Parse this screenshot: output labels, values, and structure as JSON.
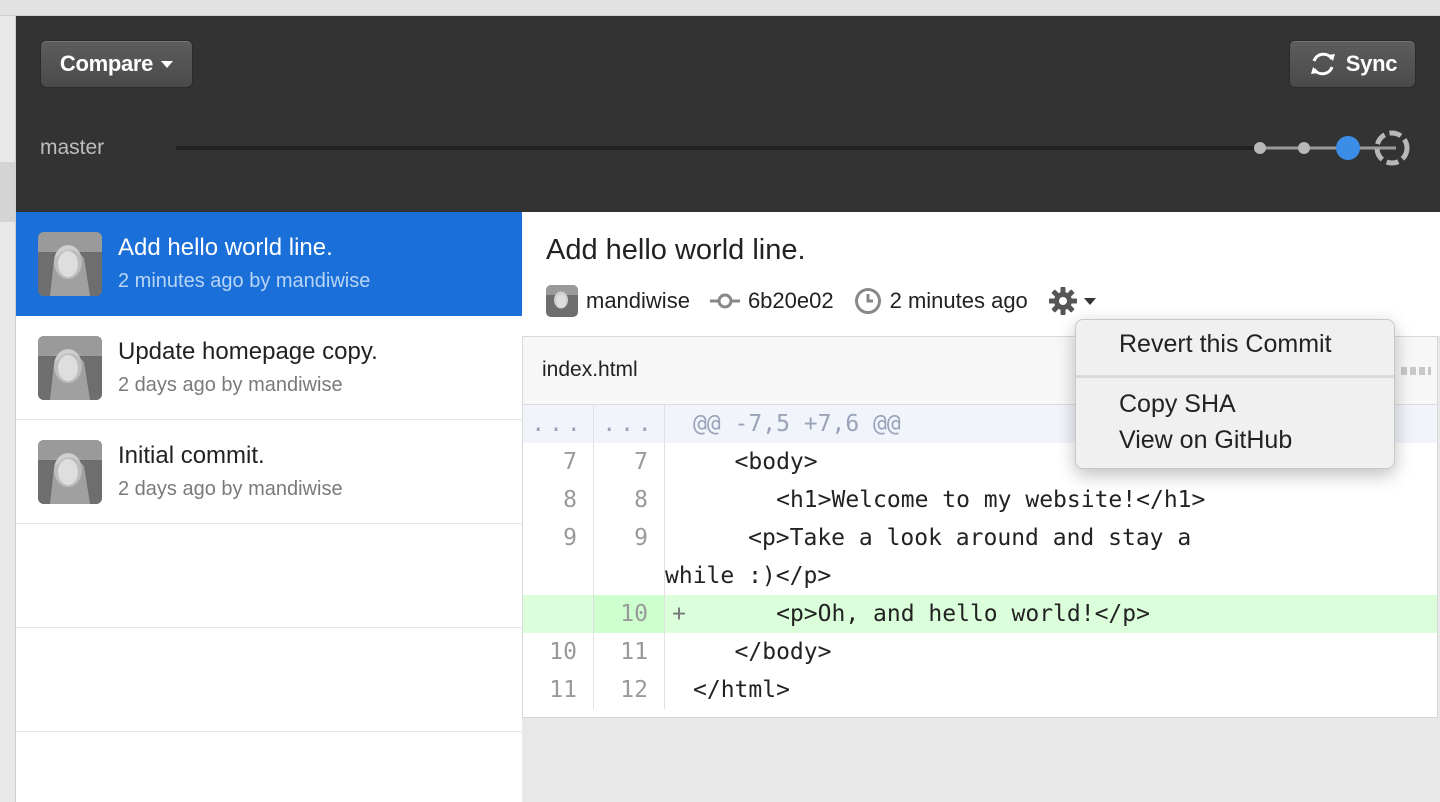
{
  "toolbar": {
    "compare_label": "Compare",
    "sync_label": "Sync",
    "branch": "master"
  },
  "commits": [
    {
      "title": "Add hello world line.",
      "meta": "2 minutes ago by mandiwise",
      "selected": true
    },
    {
      "title": "Update homepage copy.",
      "meta": "2 days ago by mandiwise",
      "selected": false
    },
    {
      "title": "Initial commit.",
      "meta": "2 days ago by mandiwise",
      "selected": false
    }
  ],
  "detail": {
    "title": "Add hello world line.",
    "author": "mandiwise",
    "sha": "6b20e02",
    "time": "2 minutes ago"
  },
  "file": {
    "name": "index.html",
    "hunk_header": "@@ -7,5 +7,6 @@",
    "lines": [
      {
        "old": "7",
        "new": "7",
        "sign": "",
        "code": "   <body>"
      },
      {
        "old": "8",
        "new": "8",
        "sign": "",
        "code": "      <h1>Welcome to my website!</h1>"
      },
      {
        "old": "9",
        "new": "9",
        "sign": "",
        "code": "      <p>Take a look around and stay a\nwhile :)</p>"
      },
      {
        "old": "",
        "new": "10",
        "sign": "+",
        "code": "      <p>Oh, and hello world!</p>"
      },
      {
        "old": "10",
        "new": "11",
        "sign": "",
        "code": "   </body>"
      },
      {
        "old": "11",
        "new": "12",
        "sign": "",
        "code": "</html>"
      }
    ],
    "hunk_ellipsis": "..."
  },
  "menu": {
    "revert": "Revert this Commit",
    "copy_sha": "Copy SHA",
    "view_github": "View on GitHub"
  },
  "colors": {
    "selected": "#1a6fd9",
    "toolbar": "#333333",
    "added": "#dbffdb",
    "timeline_active": "#3a8ee6"
  }
}
